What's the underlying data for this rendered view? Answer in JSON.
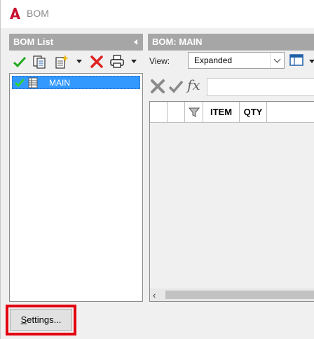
{
  "window": {
    "title": "BOM"
  },
  "bom_list_panel": {
    "header": "BOM List",
    "toolbar": [
      "validate-check",
      "copy-bom",
      "new-bom",
      "delete",
      "print"
    ],
    "tree": [
      {
        "label": "MAIN",
        "selected": true,
        "checked": true
      }
    ]
  },
  "bom_panel": {
    "header": "BOM: MAIN",
    "view_label": "View:",
    "view_value": "Expanded",
    "formula_label": "fx",
    "formula_value": "",
    "columns": [
      "",
      "",
      "",
      "ITEM",
      "QTY"
    ]
  },
  "footer": {
    "settings_label_prefix": "S",
    "settings_label_rest": "ettings..."
  },
  "colors": {
    "selection": "#3399ff",
    "header_bg": "#a6a6a6",
    "highlight": "#e3000f",
    "check": "#22aa22",
    "delete": "#dd2222"
  }
}
